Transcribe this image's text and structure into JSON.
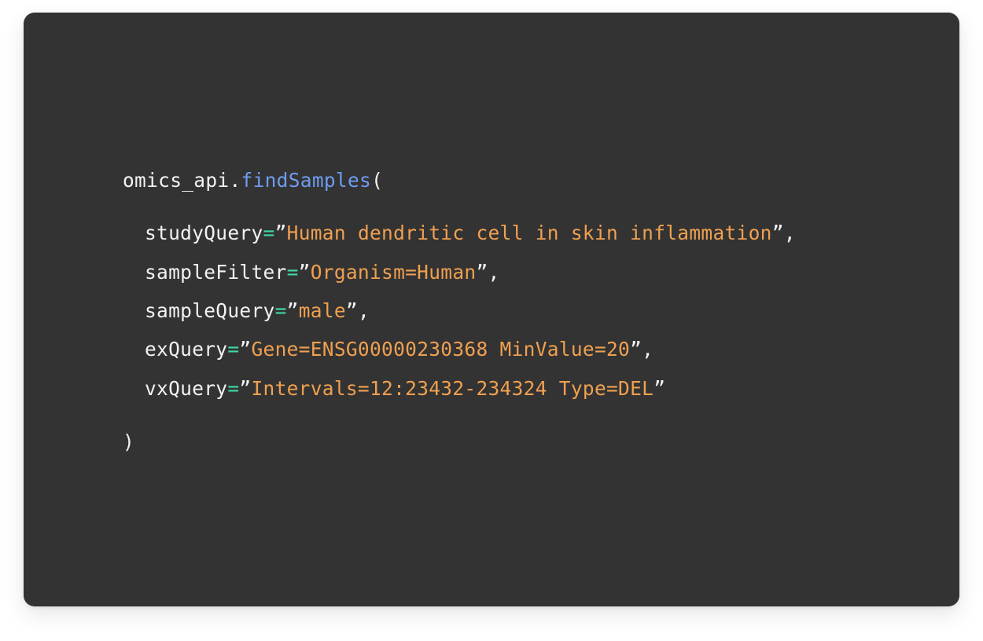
{
  "code": {
    "object": "omics_api",
    "dot": ".",
    "function": "findSamples",
    "open_paren": "(",
    "close_paren": ")",
    "params": [
      {
        "name": "studyQuery",
        "eq": "=",
        "open_quote": "”",
        "value": "Human dendritic cell in skin inflammation",
        "close": "”,"
      },
      {
        "name": "sampleFilter",
        "eq": "=",
        "open_quote": "”",
        "value": "Organism=Human",
        "close": "”,"
      },
      {
        "name": "sampleQuery",
        "eq": "=",
        "open_quote": "”",
        "value": "male",
        "close": "”,"
      },
      {
        "name": "exQuery",
        "eq": "=",
        "open_quote": "”",
        "value": "Gene=ENSG00000230368 MinValue=20",
        "close": "”,"
      },
      {
        "name": "vxQuery",
        "eq": "=",
        "open_quote": "”",
        "value": "Intervals=12:23432-234324 Type=DEL",
        "close": "”"
      }
    ]
  },
  "colors": {
    "background": "#333333",
    "text": "#f2f2f2",
    "function": "#6f9cf0",
    "operator": "#3fd9a7",
    "string": "#f0a050"
  }
}
